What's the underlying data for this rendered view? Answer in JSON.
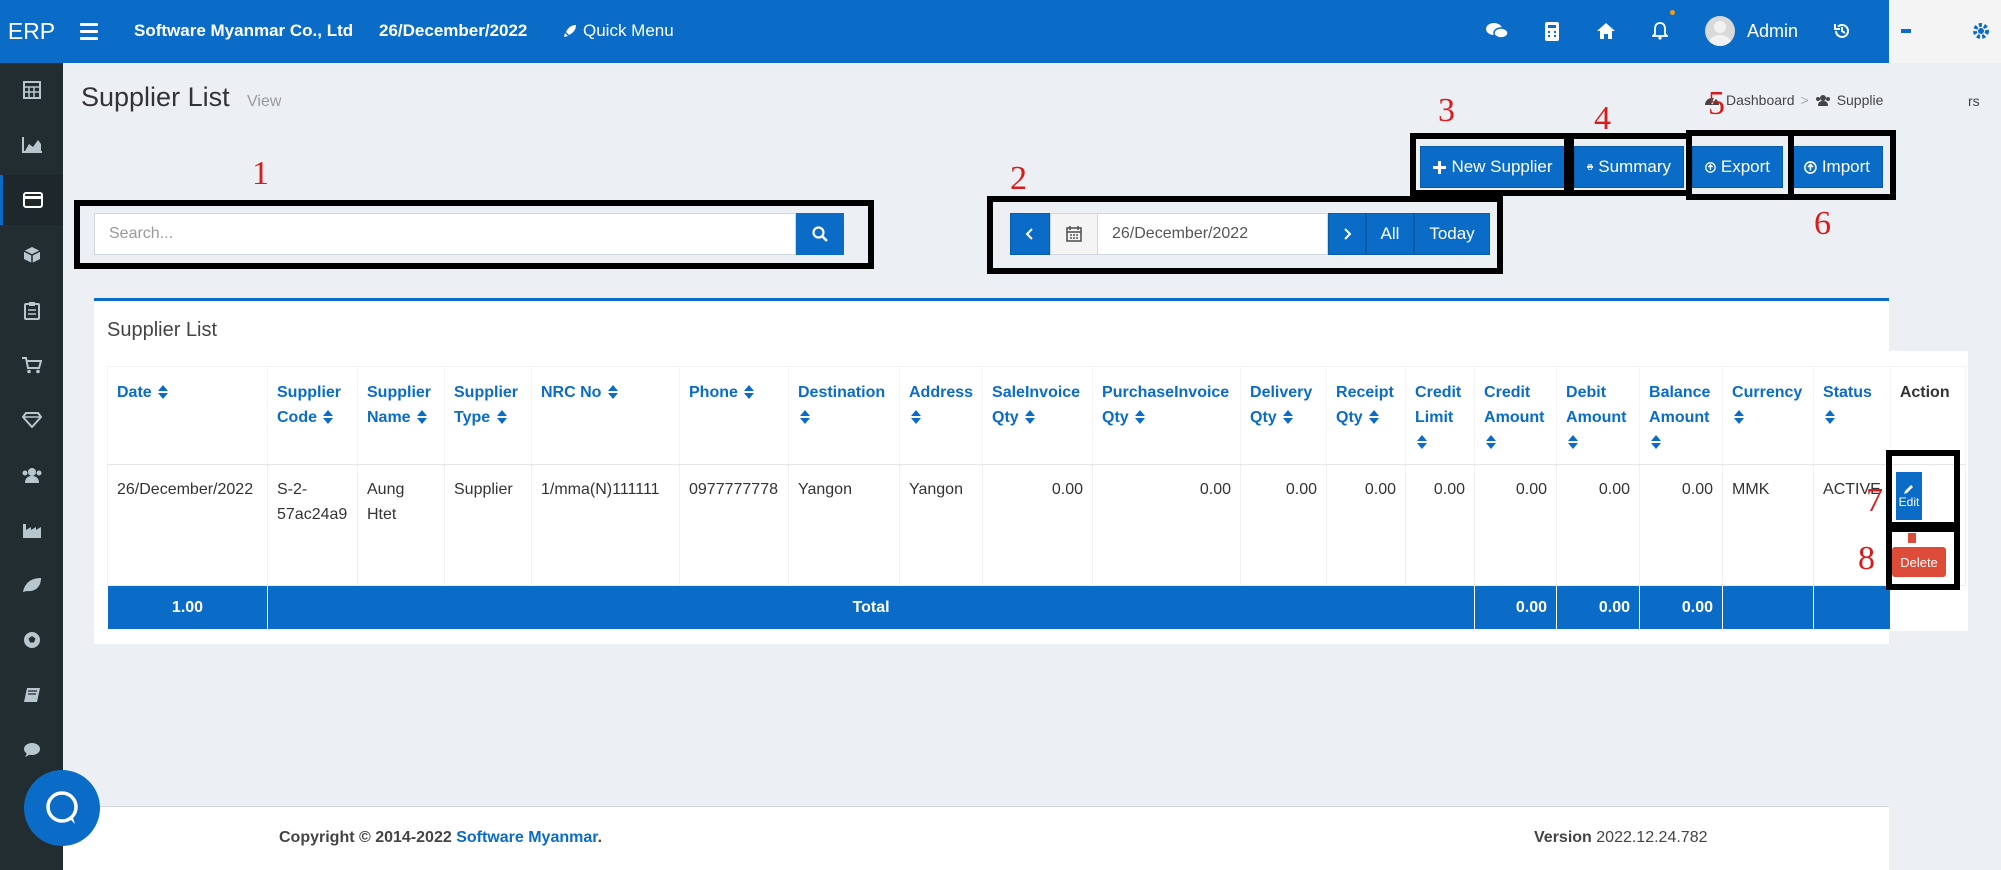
{
  "app": {
    "brand": "ERP",
    "company": "Software Myanmar Co., Ltd",
    "date": "26/December/2022",
    "quick_menu": "Quick Menu",
    "user": "Admin"
  },
  "page": {
    "title": "Supplier List",
    "subtitle": "View",
    "breadcrumb": [
      "Dashboard",
      ">",
      "Supplie"
    ],
    "breadcrumb_tail": "rs"
  },
  "search": {
    "placeholder": "Search..."
  },
  "date_filter": {
    "value": "26/December/2022",
    "all_label": "All",
    "today_label": "Today"
  },
  "actions": {
    "new_supplier": "New Supplier",
    "summary": "Summary",
    "export": "Export",
    "import": "Import"
  },
  "box": {
    "title": "Supplier List"
  },
  "table": {
    "headers": {
      "date": "Date",
      "supplier_code": "Supplier Code",
      "supplier_name": "Supplier Name",
      "supplier_type": "Supplier Type",
      "nrc_no": "NRC No",
      "phone": "Phone",
      "destination": "Destination",
      "address": "Address",
      "sale_invoice_qty": "SaleInvoice Qty",
      "purchase_invoice_qty": "PurchaseInvoice Qty",
      "delivery_qty": "Delivery Qty",
      "receipt_qty": "Receipt Qty",
      "credit_limit": "Credit Limit",
      "credit_amount": "Credit Amount",
      "debit_amount": "Debit Amount",
      "balance_amount": "Balance Amount",
      "currency": "Currency",
      "status": "Status",
      "action": "Action"
    },
    "row": {
      "date": "26/December/2022",
      "supplier_code": "S-2-57ac24a9",
      "supplier_name": "Aung Htet",
      "supplier_type": "Supplier",
      "nrc_no": "1/mma(N)111111",
      "phone": "0977777778",
      "destination": "Yangon",
      "address": "Yangon",
      "sale_invoice_qty": "0.00",
      "purchase_invoice_qty": "0.00",
      "delivery_qty": "0.00",
      "receipt_qty": "0.00",
      "credit_limit": "0.00",
      "credit_amount": "0.00",
      "debit_amount": "0.00",
      "balance_amount": "0.00",
      "currency": "MMK",
      "status": "ACTIVE",
      "edit_label": "Edit",
      "delete_label": "Delete"
    },
    "total": {
      "count": "1.00",
      "label": "Total",
      "credit_amount": "0.00",
      "debit_amount": "0.00",
      "balance_amount": "0.00"
    }
  },
  "annotations": [
    "1",
    "2",
    "3",
    "4",
    "5",
    "6",
    "7",
    "8"
  ],
  "footer": {
    "copyright": "Copyright © 2014-2022",
    "company_link": "Software Myanmar",
    "dot": ".",
    "version_label": "Version",
    "version": "2022.12.24.782"
  },
  "colors": {
    "primary": "#0a6cc7",
    "danger": "#dd4b39",
    "sidebar": "#222d32",
    "annotation": "#d81b1b"
  }
}
